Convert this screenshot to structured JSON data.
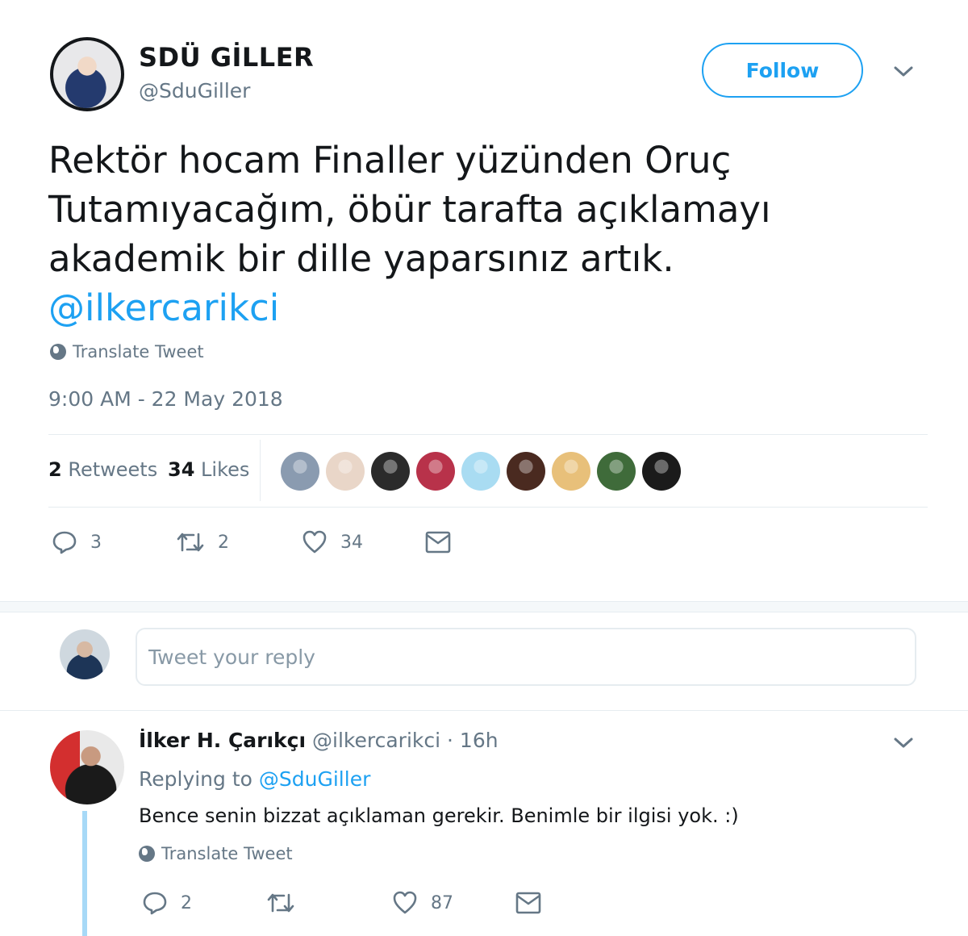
{
  "tweet": {
    "author_name": "SDÜ GİLLER",
    "author_handle": "@SduGiller",
    "follow_label": "Follow",
    "text_line1": "Rektör hocam Finaller yüzünden Oruç",
    "text_line2": "Tutamıyacağım, öbür tarafta açıklamayı",
    "text_line3": "akademik bir dille yaparsınız artık.",
    "mention": "@ilkercarikci",
    "translate_label": "Translate Tweet",
    "timestamp": "9:00 AM - 22 May 2018",
    "retweets_count": "2",
    "retweets_label": "Retweets",
    "likes_count": "34",
    "likes_label": "Likes",
    "actions": {
      "reply_count": "3",
      "retweet_count": "2",
      "like_count": "34"
    }
  },
  "reply_box": {
    "placeholder": "Tweet your reply"
  },
  "reply": {
    "name": "İlker H. Çarıkçı",
    "handle": "@ilkercarikci",
    "time": "· 16h",
    "replying_to_label": "Replying to",
    "replying_to_handle": "@SduGiller",
    "text": "Bence senin bizzat açıklaman gerekir. Benimle bir ilgisi yok. :)",
    "translate_label": "Translate Tweet",
    "actions": {
      "reply_count": "2",
      "retweet_count": "",
      "like_count": "87"
    }
  },
  "colors": {
    "accent": "#1da1f2",
    "text": "#14171a",
    "muted": "#657786",
    "border": "#e6ecf0",
    "thread": "#a7d9f7"
  },
  "icons": [
    "chevron-down-icon",
    "globe-icon",
    "reply-icon",
    "retweet-icon",
    "heart-icon",
    "envelope-icon"
  ],
  "likers": [
    {
      "color": "#8a9bb0"
    },
    {
      "color": "#e9d6c8"
    },
    {
      "color": "#2b2b2b"
    },
    {
      "color": "#b8324a"
    },
    {
      "color": "#a9dcf2"
    },
    {
      "color": "#4a2a20"
    },
    {
      "color": "#e8c07a"
    },
    {
      "color": "#3f6b3a"
    },
    {
      "color": "#1b1b1b"
    }
  ]
}
